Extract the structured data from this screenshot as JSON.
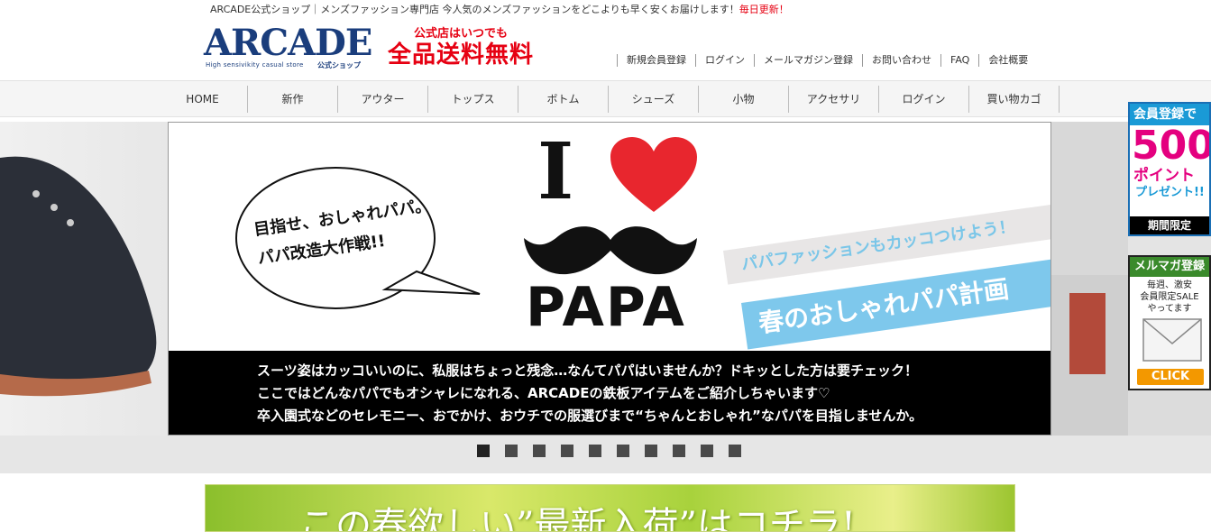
{
  "header": {
    "tagline": "ARCADE公式ショップ｜メンズファッション専門店 今人気のメンズファッションをどこよりも早く安くお届けします！",
    "tagline_update": "毎日更新！",
    "logo_text": "ARCADE",
    "logo_sub": "High sensivikity casual store",
    "logo_sub2": "公式ショップ",
    "freeship_line1": "公式店はいつでも",
    "freeship_line2": "全品送料無料",
    "links": [
      "新規会員登録",
      "ログイン",
      "メールマガジン登録",
      "お問い合わせ",
      "FAQ",
      "会社概要"
    ]
  },
  "nav": {
    "items": [
      "HOME",
      "新作",
      "アウター",
      "トップス",
      "ボトム",
      "シューズ",
      "小物",
      "アクセサリ",
      "ログイン",
      "買い物カゴ"
    ]
  },
  "banner": {
    "bubble_line1": "目指せ、おしゃれパパ。",
    "bubble_line2": "パパ改造大作戦!!",
    "i_letter": "I",
    "papa": "PAPA",
    "ribbon1": "パパファッションもカッコつけよう！",
    "ribbon2": "春のおしゃれパパ計画",
    "text_lines": [
      "スーツ姿はカッコいいのに、私服はちょっと残念…なんてパパはいませんか？ドキッとした方は要チェック！",
      "ここではどんなパパでもオシャレになれる、ARCADEの鉄板アイテムをご紹介しちゃいます♡",
      "卒入園式などのセレモニー、おでかけ、おウチでの服選びまで“ちゃんとおしゃれ”なパパを目指しませんか。"
    ]
  },
  "side_ads": {
    "member_head": "会員登録で",
    "member_points": "500",
    "member_point_label": "ポイント",
    "member_present": "プレゼント!!",
    "member_limited": "期間限定",
    "mail_head": "メルマガ登録",
    "mail_text": [
      "毎週、激安",
      "会員限定SALE",
      "やってます"
    ],
    "mail_click": "CLICK"
  },
  "slider": {
    "dot_count": 10,
    "active_index": 0
  },
  "bottom_banner": {
    "text": "この春欲しい”最新入荷”はコチラ!"
  },
  "colors": {
    "brand_navy": "#1a3d7c",
    "accent_red": "#e60012",
    "ribbon_blue": "#7ec8ec",
    "pink": "#e4007f"
  }
}
